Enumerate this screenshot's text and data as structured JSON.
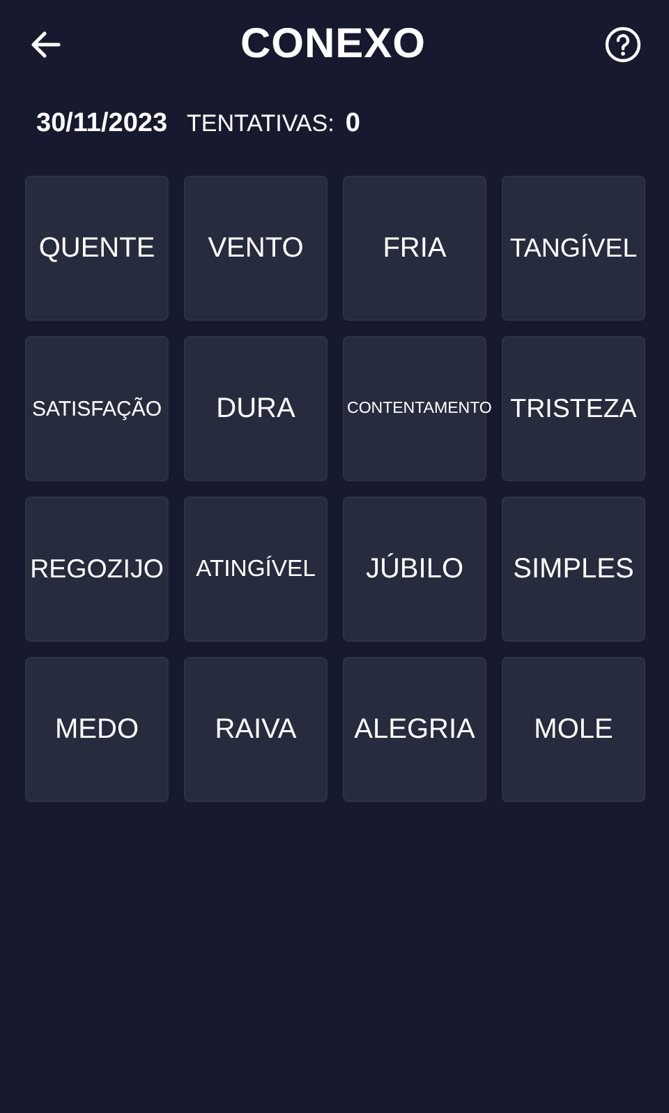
{
  "header": {
    "title": "CONEXO"
  },
  "info": {
    "date": "30/11/2023",
    "attempts_label": "TENTATIVAS:",
    "attempts": "0"
  },
  "tiles": [
    {
      "word": "QUENTE",
      "selected": false
    },
    {
      "word": "VENTO",
      "selected": false
    },
    {
      "word": "FRIA",
      "selected": false
    },
    {
      "word": "TANGÍVEL",
      "selected": false
    },
    {
      "word": "SATISFAÇÃO",
      "selected": false
    },
    {
      "word": "DURA",
      "selected": false
    },
    {
      "word": "CONTENTAMENTO",
      "selected": false
    },
    {
      "word": "TRISTEZA",
      "selected": false
    },
    {
      "word": "REGOZIJO",
      "selected": false
    },
    {
      "word": "ATINGÍVEL",
      "selected": false
    },
    {
      "word": "JÚBILO",
      "selected": false
    },
    {
      "word": "SIMPLES",
      "selected": false
    },
    {
      "word": "MEDO",
      "selected": false
    },
    {
      "word": "RAIVA",
      "selected": false
    },
    {
      "word": "ALEGRIA",
      "selected": false
    },
    {
      "word": "MOLE",
      "selected": false
    }
  ]
}
